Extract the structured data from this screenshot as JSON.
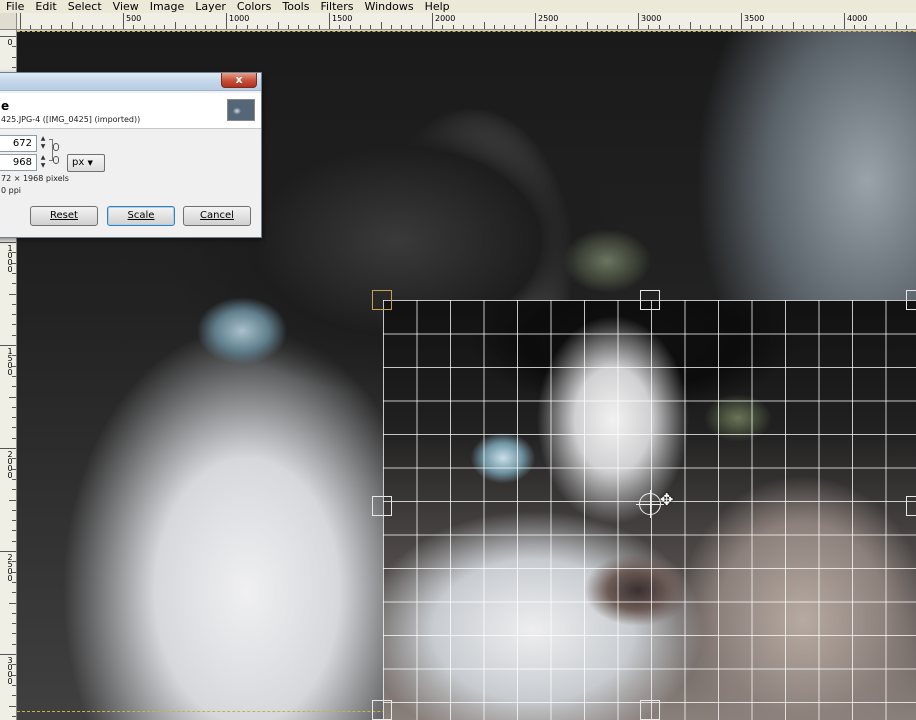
{
  "menubar": {
    "items": [
      {
        "label": "File"
      },
      {
        "label": "Edit"
      },
      {
        "label": "Select"
      },
      {
        "label": "View"
      },
      {
        "label": "Image"
      },
      {
        "label": "Layer"
      },
      {
        "label": "Colors"
      },
      {
        "label": "Tools"
      },
      {
        "label": "Filters"
      },
      {
        "label": "Windows"
      },
      {
        "label": "Help"
      }
    ]
  },
  "ruler": {
    "horizontal_labels": [
      "500",
      "1000",
      "1500",
      "2000",
      "2500",
      "3000",
      "3500",
      "4000"
    ],
    "vertical_labels": [
      "0",
      "500",
      "1000",
      "1500",
      "2000",
      "2500",
      "3000"
    ]
  },
  "scale_dialog": {
    "close_label": "x",
    "title": "e",
    "subtitle": "425.JPG-4 ([IMG_0425] (imported))",
    "width_value": "672",
    "height_value": "968",
    "unit": "px",
    "size_info": "72 × 1968 pixels",
    "resolution_info": "0 ppi",
    "buttons": {
      "reset": "Reset",
      "scale": "Scale",
      "cancel": "Cancel"
    }
  },
  "icons": {
    "close": "close-icon",
    "chain": "chain-icon",
    "move_cursor": "move-cursor-icon",
    "spin_up": "spin-up-icon",
    "spin_down": "spin-down-icon",
    "dropdown": "chevron-down-icon"
  }
}
